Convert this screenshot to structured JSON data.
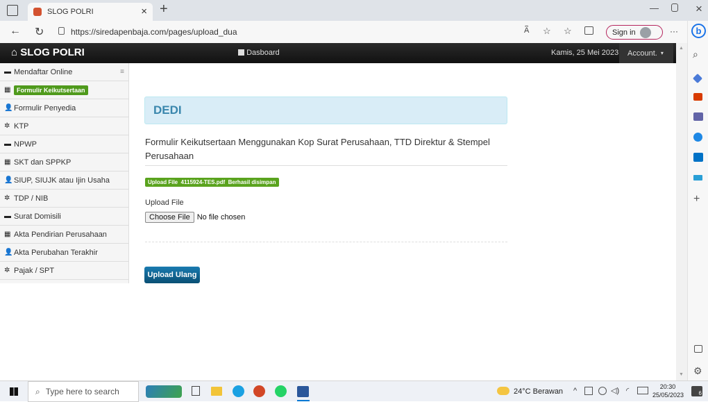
{
  "browser": {
    "tab_title": "SLOG POLRI",
    "tab_close": "×",
    "new_tab": "+",
    "url": "https://siredapenbaja.com/pages/upload_dua",
    "sign_in": "Sign in",
    "more": "···",
    "win_min": "—",
    "win_restore": "□",
    "win_close": "×"
  },
  "navbar": {
    "brand": "SLOG POLRI",
    "dashboard": "Dasboard",
    "date": "Kamis, 25 Mei 2023",
    "account": "Account."
  },
  "sidebar": {
    "items": [
      {
        "label": "Mendaftar Online",
        "icon": "folder-icon"
      },
      {
        "label": "Formulir Keikutsertaan",
        "icon": "th-icon",
        "active": true
      },
      {
        "label": "Formulir Penyedia",
        "icon": "user-icon"
      },
      {
        "label": "KTP",
        "icon": "gear-icon"
      },
      {
        "label": "NPWP",
        "icon": "folder-icon"
      },
      {
        "label": "SKT dan SPPKP",
        "icon": "th-icon"
      },
      {
        "label": "SIUP, SIUJK atau Ijin Usaha",
        "icon": "user-icon"
      },
      {
        "label": "TDP / NIB",
        "icon": "gear-icon"
      },
      {
        "label": "Surat Domisili",
        "icon": "folder-icon"
      },
      {
        "label": "Akta Pendirian Perusahaan",
        "icon": "th-icon"
      },
      {
        "label": "Akta Perubahan Terakhir",
        "icon": "user-icon"
      },
      {
        "label": "Pajak / SPT",
        "icon": "gear-icon"
      }
    ]
  },
  "main": {
    "name_header": "DEDI",
    "form_title": "Formulir Keikutsertaan Menggunakan Kop Surat Perusahaan, TTD Direktur & Stempel Perusahaan",
    "upload_badge": "Upload File  4115924-TES.pdf  Berhasil disimpan",
    "upload_label": "Upload File",
    "choose_file": "Choose File",
    "no_file": "No file chosen",
    "reupload_button": "Upload Ulang"
  },
  "taskbar": {
    "search_placeholder": "Type here to search",
    "weather": "24°C Berawan",
    "time": "20:30",
    "date": "25/05/2023",
    "notif_count": "6"
  },
  "colors": {
    "navbar": "#1b1b1b",
    "header_bg": "#d9edf7",
    "header_text": "#3a87ad",
    "badge_green": "#5aa31e",
    "primary_btn": "#0b5e8a"
  }
}
